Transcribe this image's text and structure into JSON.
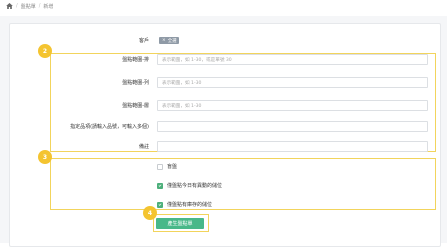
{
  "breadcrumb": [
    "盤點單",
    "新增"
  ],
  "form": {
    "customer_label": "客戶",
    "customer_chip": "全選",
    "row_label": "盤點範圍-排",
    "row_placeholder": "表示範圍，如 1-30，或是單號 30",
    "column_label": "盤點範圍-列",
    "column_placeholder": "表示範圍，如 1-30",
    "layer_label": "盤點範圍-層",
    "layer_placeholder": "表示範圍，如 1-30",
    "items_label": "指定品項(請輸入品號，可輸入多個)",
    "items_value": "",
    "note_label": "備註",
    "note_value": ""
  },
  "options": [
    {
      "label": "盲盤",
      "checked": false
    },
    {
      "label": "僅盤點今日有異動的儲位",
      "checked": true
    },
    {
      "label": "僅盤點有庫存的儲位",
      "checked": true
    }
  ],
  "submit_label": "產生盤點單",
  "badges": [
    "2",
    "3",
    "4"
  ],
  "colors": {
    "accent": "#48b889",
    "highlight": "#f2d45c",
    "badge": "#f4c430"
  }
}
